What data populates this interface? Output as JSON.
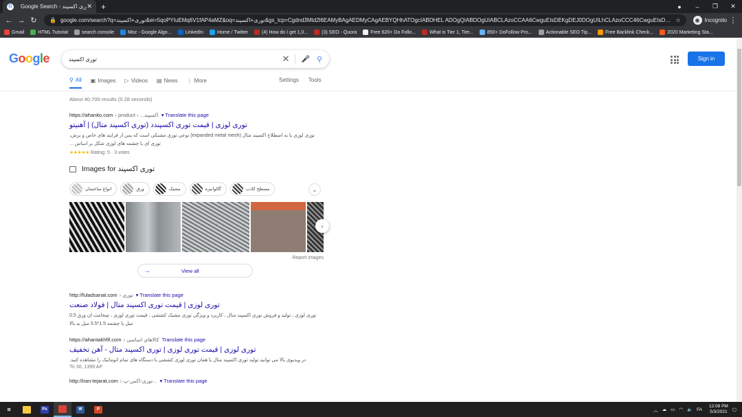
{
  "browser": {
    "tab_title": "Google Search - توری اکسپند",
    "tab_close": "✕",
    "new_tab": "+",
    "url": "google.com/search?q=توری+اکسپند&ei=5qoPYIuEMq6V1fAP4aMZ&oq=توری+اکسپند&gs_lcp=Cgdnd3Mtd2l6EAMyBAgAEDMyCAgAEBYQHhATOgcIABDHEL ADOgQIABDOgUIABCLAzoCCAA6CwguEIsDEKgDEJ0DOgUILhCLAzoCCC46CwguEIsDEKgDEJoDOg...",
    "incognito_label": "Incognito",
    "bookmarks": [
      {
        "label": "Gmail",
        "color": "#ea4335"
      },
      {
        "label": "HTML Tutorial",
        "color": "#4caf50"
      },
      {
        "label": "search console",
        "color": "#9e9e9e"
      },
      {
        "label": "Moz - Google Algo...",
        "color": "#1e88e5"
      },
      {
        "label": "LinkedIn",
        "color": "#0a66c2"
      },
      {
        "label": "Home / Twitter",
        "color": "#1da1f2"
      },
      {
        "label": "(4) How do I get 1,0...",
        "color": "#b92b27"
      },
      {
        "label": "(3) SEO - Quora",
        "color": "#b92b27"
      },
      {
        "label": "Free 620+ Do Follo...",
        "color": "#f0f0f0"
      },
      {
        "label": "What is Tier 1, Tier...",
        "color": "#b92b27"
      },
      {
        "label": "850+ DoFollow Pro...",
        "color": "#64b5f6"
      },
      {
        "label": "Actionable SEO Tip...",
        "color": "#9e9e9e"
      },
      {
        "label": "Free Backlink Check...",
        "color": "#ff9800"
      },
      {
        "label": "2020 Marketing Sta...",
        "color": "#ff5722"
      }
    ]
  },
  "google": {
    "query": "توری اکسپند",
    "sign_in": "Sign in",
    "tabs": [
      {
        "label": "All",
        "icon": "⚲"
      },
      {
        "label": "Images",
        "icon": "▣"
      },
      {
        "label": "Videos",
        "icon": "▷"
      },
      {
        "label": "News",
        "icon": "▤"
      },
      {
        "label": "More",
        "icon": "⋮"
      }
    ],
    "settings": "Settings",
    "tools": "Tools",
    "stats": "About 40,700 results (0.28 seconds)"
  },
  "results": [
    {
      "site": "https://ahanito.com",
      "path": "› product › ...اکسپند",
      "translate": "Translate this page",
      "title": "توری لوزی | قیمت توری اکسپندد (توری اکسپند متال) | آهنیتو",
      "snippet": "توری لوزی یا به اصطلاح اکسپند متال (expanded metal mesh) نوعی توری مشبکی است که پس از فرایند های خاص و برش، توری ای با چشمه های لوزی شکل بر اساس ...",
      "rating_stars": "★★★★★",
      "rating_text": "Rating: 5 · 3 votes"
    },
    {
      "site": "http://fuladsanat.com",
      "path": "› توری",
      "translate": "Translate this page",
      "title": "توری لوزی | قیمت توری اکسپند متال | فولاد صنعت",
      "snippet": "توری لوزی ، تولید و فروش توری اکسپند متال ، کاربرد و ویژگی توری مشبک کششی ، قیمت توری لوزی ، ضخامت ان ورق 0.5 میل با چشمه 1.5*3.5 میل به بالا",
      "date": ""
    },
    {
      "site": "https://ahantakhfif.com",
      "path": "› کالاهای اساسی",
      "translate": "Translate this page",
      "title": "توری لوزی | قیمت توری لوزی | توری اکسپند متال - آهن تخفیف",
      "snippet": "در ویدیوی بالا می توانید تولید توری اکسپند متال یا همان توری لوزی کششی با دستگاه های تمام اتوماتیک را مشاهده کنید.",
      "date": "Tir 30, 1399 AP"
    },
    {
      "site": "http://iran-tejarat.com",
      "path": "› توری-اکس-پ...",
      "translate": "Translate this page"
    }
  ],
  "images": {
    "title": "Images for توری اکسپند",
    "chips": [
      "مسطح کاذب",
      "گالوانیزه",
      "مشبک",
      "ورق",
      "انواع ساختمان"
    ],
    "report": "Report images",
    "view_all": "View all",
    "tiles": [
      "#1a1a1a",
      "#8e9497",
      "#b9bcbe",
      "#a58a7f",
      "#4a4a4a"
    ]
  },
  "taskbar": {
    "apps": [
      {
        "name": "start",
        "label": "⊞",
        "color": "#1f1f1f"
      },
      {
        "name": "explorer",
        "label": "",
        "color": "#f9c942"
      },
      {
        "name": "photoshop",
        "label": "Ps",
        "color": "#2b3fb0"
      },
      {
        "name": "chrome",
        "label": "",
        "color": "#db4437"
      },
      {
        "name": "word",
        "label": "W",
        "color": "#2b579a"
      },
      {
        "name": "powerpoint",
        "label": "P",
        "color": "#d24726"
      }
    ],
    "tray_lang": "FA",
    "time": "12:08 PM",
    "date": "5/3/2021"
  }
}
